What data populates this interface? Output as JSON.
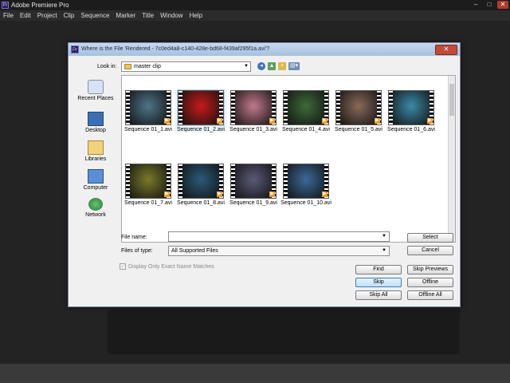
{
  "app": {
    "title": "Adobe Premiere Pro",
    "icon_label": "Pr"
  },
  "window_controls": {
    "minimize": "–",
    "maximize": "□",
    "close": "✕"
  },
  "menu": [
    "File",
    "Edit",
    "Project",
    "Clip",
    "Sequence",
    "Marker",
    "Title",
    "Window",
    "Help"
  ],
  "dialog": {
    "title": "Where is the File 'Rendered - 7c0ed4a8-c140-428e-bd68-f439af295f1a.avi'?",
    "close_glyph": "✕",
    "look_in_label": "Look in:",
    "look_in_value": "master clip",
    "dropdown_arrow": "▼",
    "nav_glyphs": {
      "back": "◂",
      "up": "▲",
      "new_folder": "+",
      "views": "▤▾"
    },
    "places": [
      {
        "label": "Recent Places",
        "icon": "recent-places-icon"
      },
      {
        "label": "Desktop",
        "icon": "desktop-icon"
      },
      {
        "label": "Libraries",
        "icon": "libraries-icon"
      },
      {
        "label": "Computer",
        "icon": "computer-icon"
      },
      {
        "label": "Network",
        "icon": "network-icon"
      }
    ],
    "files": [
      {
        "name": "Sequence 01_1.avi",
        "color": "#4f7488"
      },
      {
        "name": "Sequence 01_2.avi",
        "color": "#c81a1a",
        "selected": true
      },
      {
        "name": "Sequence 01_3.avi",
        "color": "#c27a8c"
      },
      {
        "name": "Sequence 01_4.avi",
        "color": "#3d6a3a"
      },
      {
        "name": "Sequence 01_5.avi",
        "color": "#8a6a5a"
      },
      {
        "name": "Sequence 01_6.avi",
        "color": "#3a8aa8"
      },
      {
        "name": "Sequence 01_7.avi",
        "color": "#7a7a2a"
      },
      {
        "name": "Sequence 01_8.avi",
        "color": "#2a5a78"
      },
      {
        "name": "Sequence 01_9.avi",
        "color": "#5a5a78"
      },
      {
        "name": "Sequence 01_10.avi",
        "color": "#3a6a98"
      }
    ],
    "play_glyph": "▶",
    "file_name_label": "File name:",
    "file_name_value": "",
    "files_of_type_label": "Files of type:",
    "files_of_type_value": "All Supported Files",
    "checkbox_label": "Display Only Exact Name Matches",
    "checkbox_glyph": "✓",
    "buttons": {
      "select": "Select",
      "cancel": "Cancel",
      "find": "Find",
      "skip_previews": "Skip Previews",
      "skip": "Skip",
      "offline": "Offline",
      "skip_all": "Skip All",
      "offline_all": "Offline All"
    }
  }
}
